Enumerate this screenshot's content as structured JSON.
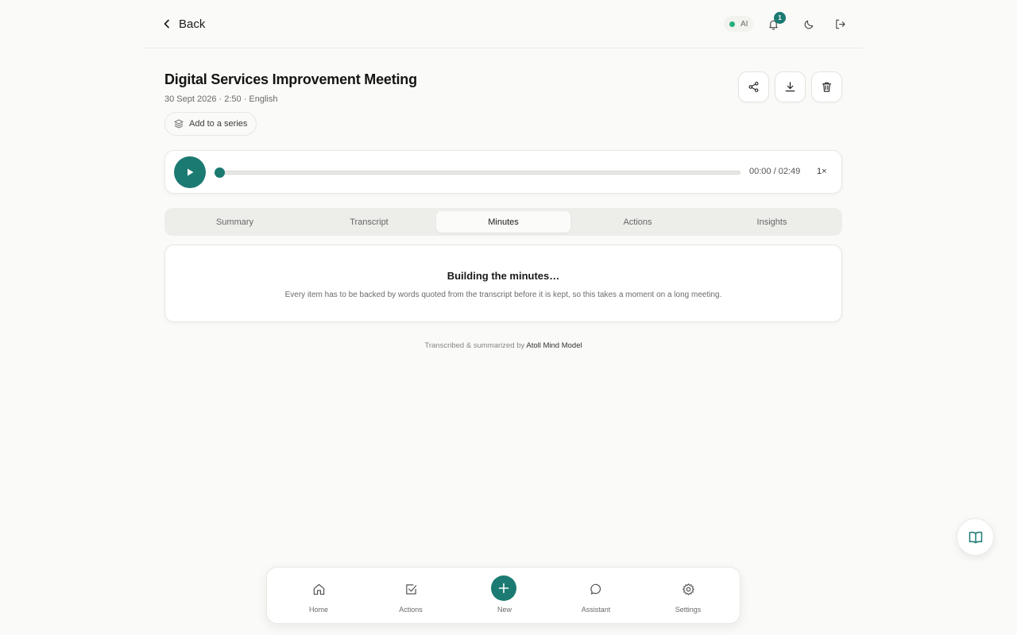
{
  "header": {
    "back_label": "Back",
    "ai_status_label": "AI",
    "notification_count": "1"
  },
  "meeting": {
    "title": "Digital Services Improvement Meeting",
    "meta": "30 Sept 2026 · 2:50 · English",
    "add_series_label": "Add to a series"
  },
  "player": {
    "time": "00:00 / 02:49",
    "speed": "1×",
    "progress": 0
  },
  "tabs": [
    {
      "label": "Summary"
    },
    {
      "label": "Transcript"
    },
    {
      "label": "Minutes"
    },
    {
      "label": "Actions"
    },
    {
      "label": "Insights"
    }
  ],
  "active_tab": "Minutes",
  "minutes_card": {
    "title": "Building the minutes…",
    "description": "Every item has to be backed by words quoted from the transcript before it is kept, so this takes a moment on a long meeting."
  },
  "footer": {
    "credit_prefix": "Transcribed & summarized by ",
    "credit_model": "Atoll Mind Model"
  },
  "bottom_nav": [
    {
      "label": "Home",
      "icon": "home-icon"
    },
    {
      "label": "Actions",
      "icon": "checkbox-icon"
    },
    {
      "label": "New",
      "icon": "plus-icon"
    },
    {
      "label": "Assistant",
      "icon": "chat-bubble-icon"
    },
    {
      "label": "Settings",
      "icon": "gear-icon"
    }
  ],
  "colors": {
    "accent": "#1b7a72",
    "ai_status": "#22b07d",
    "background": "#fafaf8"
  }
}
